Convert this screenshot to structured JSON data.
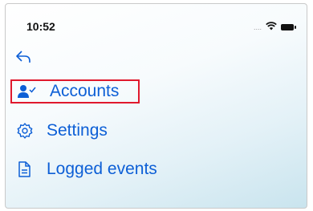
{
  "status_bar": {
    "time": "10:52",
    "signal": "....",
    "icons": [
      "wifi-icon",
      "battery-icon"
    ]
  },
  "nav": {
    "back_icon": "back-arrow-icon"
  },
  "menu": {
    "items": [
      {
        "label": "Accounts",
        "icon": "account-check-icon",
        "highlighted": true
      },
      {
        "label": "Settings",
        "icon": "gear-icon",
        "highlighted": false
      },
      {
        "label": "Logged events",
        "icon": "document-icon",
        "highlighted": false
      }
    ]
  },
  "colors": {
    "accent": "#0d5fd6",
    "highlight_border": "#e0192d"
  }
}
